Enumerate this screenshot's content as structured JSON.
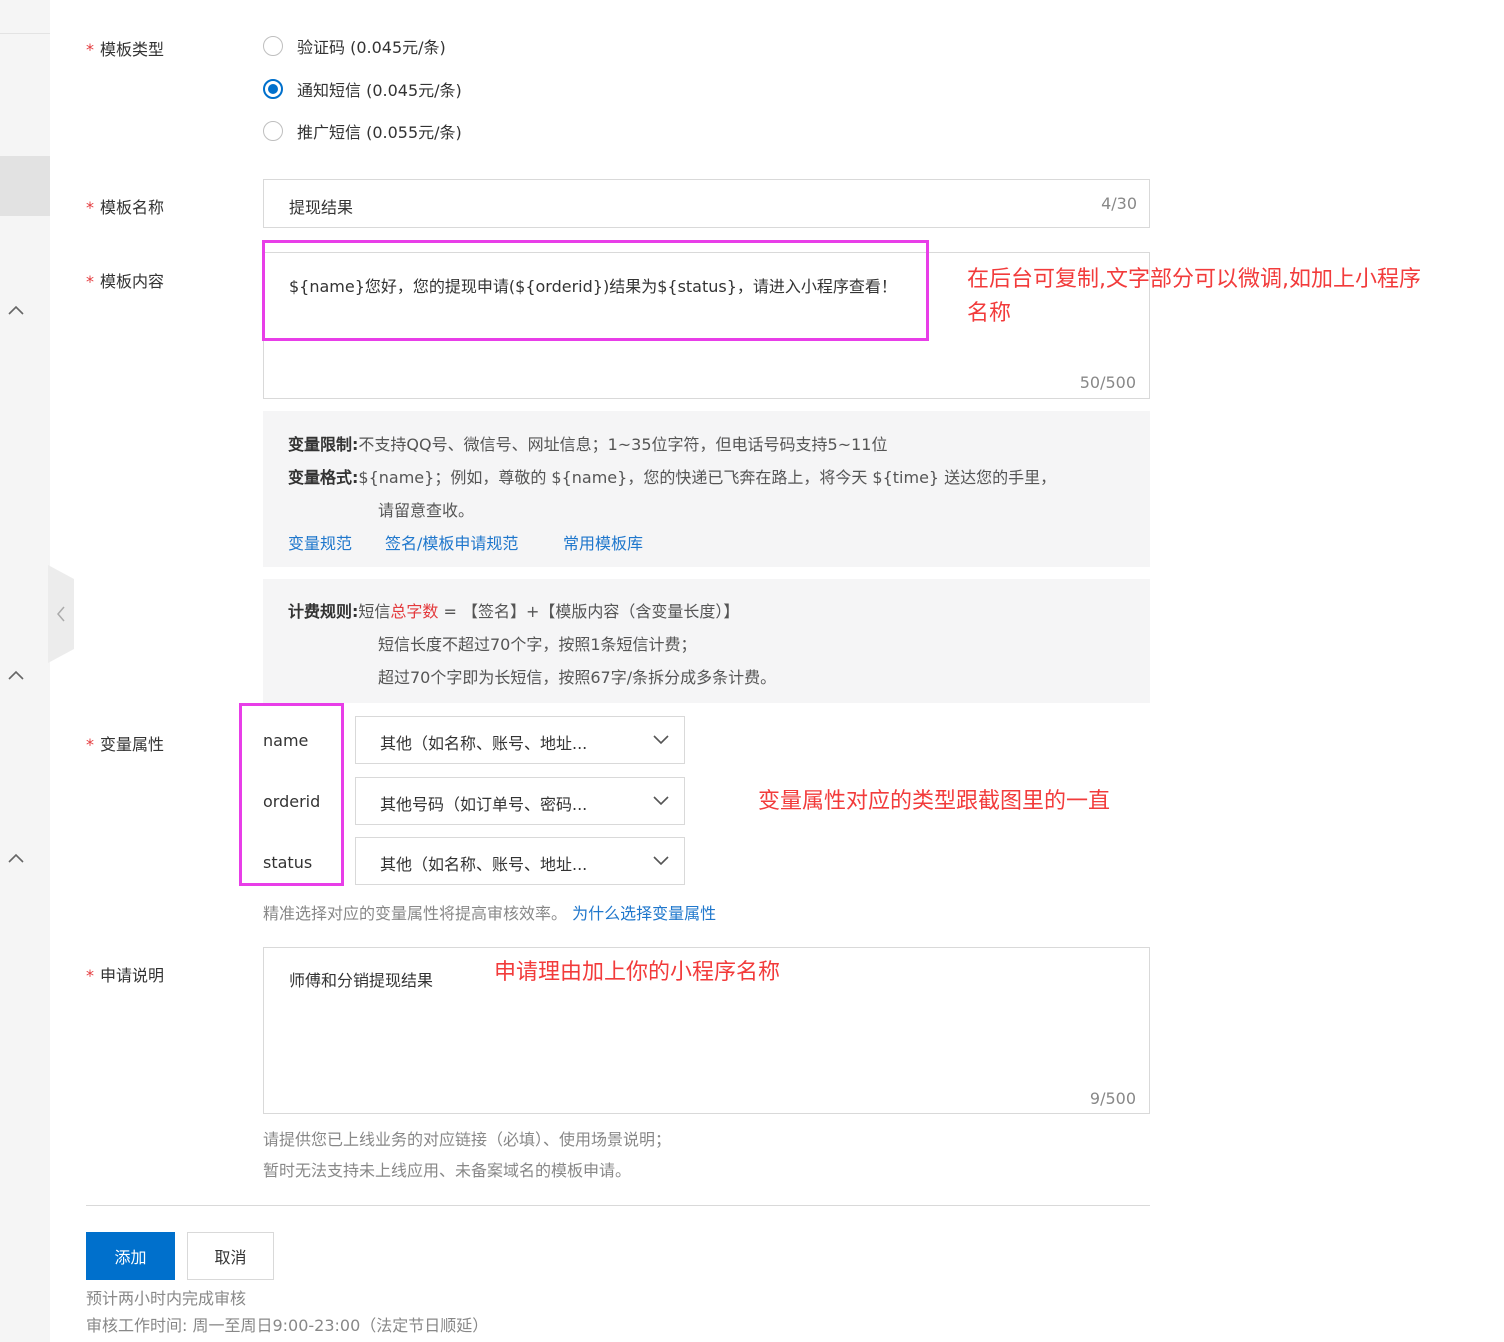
{
  "form": {
    "template_type": {
      "label": "模板类型",
      "options": [
        {
          "label": "验证码 (0.045元/条)",
          "checked": false
        },
        {
          "label": "通知短信 (0.045元/条)",
          "checked": true
        },
        {
          "label": "推广短信 (0.055元/条)",
          "checked": false
        }
      ]
    },
    "template_name": {
      "label": "模板名称",
      "value": "提现结果",
      "count": "4/30"
    },
    "template_content": {
      "label": "模板内容",
      "value": "${name}您好，您的提现申请(${orderid})结果为${status}，请进入小程序查看！",
      "count": "50/500"
    },
    "variable_info": {
      "limit_title": "变量限制:",
      "limit_text": "不支持QQ号、微信号、网址信息；1~35位字符，但电话号码支持5~11位",
      "format_title": "变量格式:",
      "format_text": "${name}；例如，尊敬的 ${name}，您的快递已飞奔在路上，将今天 ${time} 送达您的手里，",
      "format_text2": "请留意查收。",
      "links": [
        "变量规范",
        "签名/模板申请规范",
        "常用模板库"
      ]
    },
    "billing_info": {
      "title": "计费规则:",
      "line1_prefix": "短信",
      "line1_highlight": "总字数",
      "line1_suffix": " = 【签名】+【模版内容（含变量长度）】",
      "line2": "短信长度不超过70个字，按照1条短信计费；",
      "line3": "超过70个字即为长短信，按照67字/条拆分成多条计费。"
    },
    "variable_attrs": {
      "label": "变量属性",
      "items": [
        {
          "name": "name",
          "type": "其他（如名称、账号、地址..."
        },
        {
          "name": "orderid",
          "type": "其他号码（如订单号、密码..."
        },
        {
          "name": "status",
          "type": "其他（如名称、账号、地址..."
        }
      ],
      "hint": "精准选择对应的变量属性将提高审核效率。",
      "hint_link": "为什么选择变量属性"
    },
    "application_note": {
      "label": "申请说明",
      "value": "师傅和分销提现结果",
      "count": "9/500",
      "hint1": "请提供您已上线业务的对应链接（必填）、使用场景说明；",
      "hint2": "暂时无法支持未上线应用、未备案域名的模板申请。"
    }
  },
  "buttons": {
    "add": "添加",
    "cancel": "取消"
  },
  "footer": {
    "review_time": "预计两小时内完成审核",
    "work_hours": "审核工作时间: 周一至周日9:00-23:00（法定节日顺延）"
  },
  "annotations": {
    "content_note_line1": "在后台可复制,文字部分可以微调,如加上小程序",
    "content_note_line2": "名称",
    "variable_note": "变量属性对应的类型跟截图里的一直",
    "application_note": "申请理由加上你的小程序名称"
  },
  "colors": {
    "primary": "#0070cc",
    "link": "#1f77cc",
    "required": "#e4393c",
    "annotation_box": "#e83ee8",
    "annotation_text": "#f23b3b"
  },
  "icons": {
    "sidebar_caret": "chevron-up-icon",
    "select_arrow": "chevron-down-icon",
    "collapse": "chevron-left-icon"
  }
}
